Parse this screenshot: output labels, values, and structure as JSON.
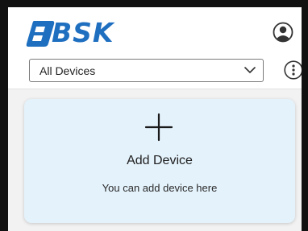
{
  "header": {
    "brand": "BSK",
    "account_icon": "user-circle-icon",
    "brand_color": "#1f6fc0"
  },
  "device_filter": {
    "selected": "All Devices",
    "dropdown_icon": "chevron-down-icon"
  },
  "menu": {
    "icon": "more-vertical-icon"
  },
  "add_device_card": {
    "icon": "plus-icon",
    "title": "Add Device",
    "subtitle": "You can add device here",
    "background": "#e4f2fb"
  }
}
